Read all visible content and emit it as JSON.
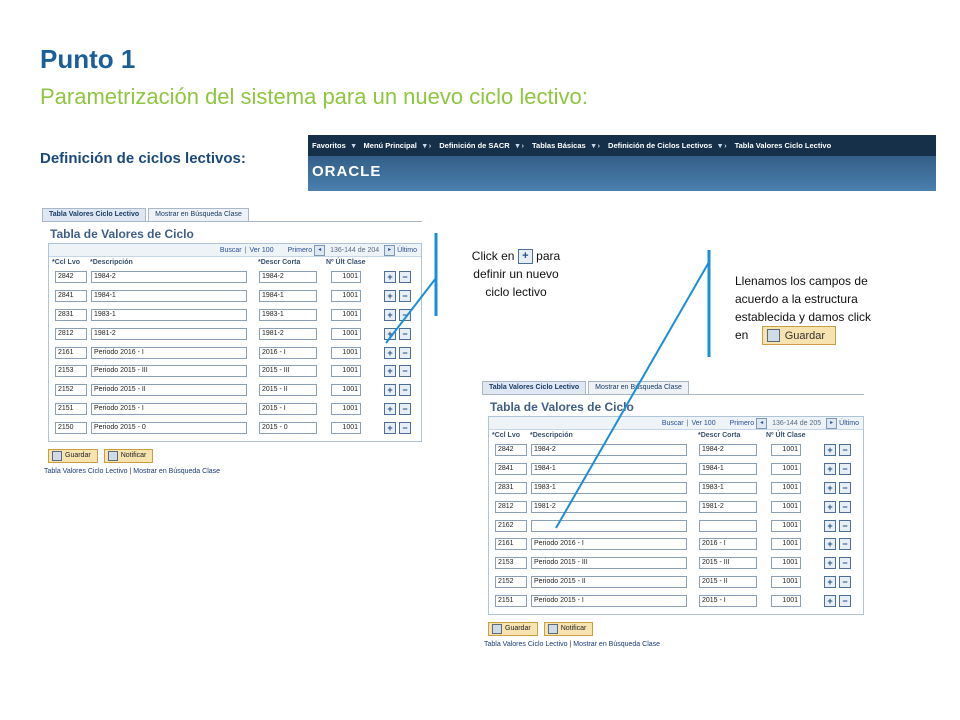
{
  "slide": {
    "title": "Punto 1",
    "subtitle": "Parametrización del sistema para un nuevo ciclo lectivo:",
    "section_label": "Definición de ciclos lectivos:"
  },
  "banner": {
    "nav_items": [
      "Favoritos",
      "Menú Principal",
      "Definición de SACR",
      "Tablas Básicas",
      "Definición de Ciclos Lectivos",
      "Tabla Valores Ciclo Lectivo"
    ],
    "logo": "ORACLE"
  },
  "note_plus": {
    "line1_a": "Click en",
    "line1_b": "para",
    "line2": "definir un nuevo",
    "line3": "ciclo lectivo",
    "plus_glyph": "+"
  },
  "note_save": {
    "line1": "Llenamos los campos de",
    "line2": "acuerdo a la estructura",
    "line3": "establecida y damos click",
    "line4": "en",
    "button_label": "Guardar"
  },
  "panel_left": {
    "tabs": [
      "Tabla Valores Ciclo Lectivo",
      "Mostrar en Búsqueda Clase"
    ],
    "title": "Tabla de Valores de Ciclo",
    "toolbar": {
      "buscar": "Buscar",
      "sep": "|",
      "ver": "Ver 100",
      "primero": "Primero",
      "range": "136-144 de 204",
      "ultimo": "Último"
    },
    "headers": [
      "*Ccl Lvo",
      "*Descripción",
      "*Descr Corta",
      "Nº Últ Clase"
    ],
    "rows": [
      [
        "2842",
        "1984-2",
        "1984-2",
        "1001"
      ],
      [
        "2841",
        "1984-1",
        "1984-1",
        "1001"
      ],
      [
        "2831",
        "1983-1",
        "1983-1",
        "1001"
      ],
      [
        "2812",
        "1981-2",
        "1981-2",
        "1001"
      ],
      [
        "2161",
        "Periodo 2016 - I",
        "2016 - I",
        "1001"
      ],
      [
        "2153",
        "Periodo 2015 - III",
        "2015 - III",
        "1001"
      ],
      [
        "2152",
        "Periodo 2015 - II",
        "2015 - II",
        "1001"
      ],
      [
        "2151",
        "Periodo 2015 - I",
        "2015 - I",
        "1001"
      ],
      [
        "2150",
        "Periodo 2015 - 0",
        "2015 - 0",
        "1001"
      ]
    ],
    "buttons": [
      "Guardar",
      "Notificar"
    ],
    "links": [
      "Tabla Valores Ciclo Lectivo",
      "|",
      "Mostrar en Búsqueda Clase"
    ]
  },
  "panel_right": {
    "tabs": [
      "Tabla Valores Ciclo Lectivo",
      "Mostrar en Búsqueda Clase"
    ],
    "title": "Tabla de Valores de Ciclo",
    "toolbar": {
      "buscar": "Buscar",
      "sep": "|",
      "ver": "Ver 100",
      "primero": "Primero",
      "range": "136-144 de 205",
      "ultimo": "Último"
    },
    "headers": [
      "*Ccl Lvo",
      "*Descripción",
      "*Descr Corta",
      "Nº Últ Clase"
    ],
    "rows": [
      [
        "2842",
        "1984-2",
        "1984-2",
        "1001"
      ],
      [
        "2841",
        "1984-1",
        "1984-1",
        "1001"
      ],
      [
        "2831",
        "1983-1",
        "1983-1",
        "1001"
      ],
      [
        "2812",
        "1981-2",
        "1981-2",
        "1001"
      ],
      [
        "2162",
        "",
        "",
        "1001"
      ],
      [
        "2161",
        "Periodo 2016 - I",
        "2016 - I",
        "1001"
      ],
      [
        "2153",
        "Periodo 2015 - III",
        "2015 - III",
        "1001"
      ],
      [
        "2152",
        "Periodo 2015 - II",
        "2015 - II",
        "1001"
      ],
      [
        "2151",
        "Periodo 2015 - I",
        "2015 - I",
        "1001"
      ]
    ],
    "buttons": [
      "Guardar",
      "Notificar"
    ],
    "links": [
      "Tabla Valores Ciclo Lectivo",
      "|",
      "Mostrar en Búsqueda Clase"
    ]
  },
  "colors": {
    "title": "#1a5e9a",
    "subtitle": "#8dc63f",
    "accent_line": "#1a8fd8"
  }
}
